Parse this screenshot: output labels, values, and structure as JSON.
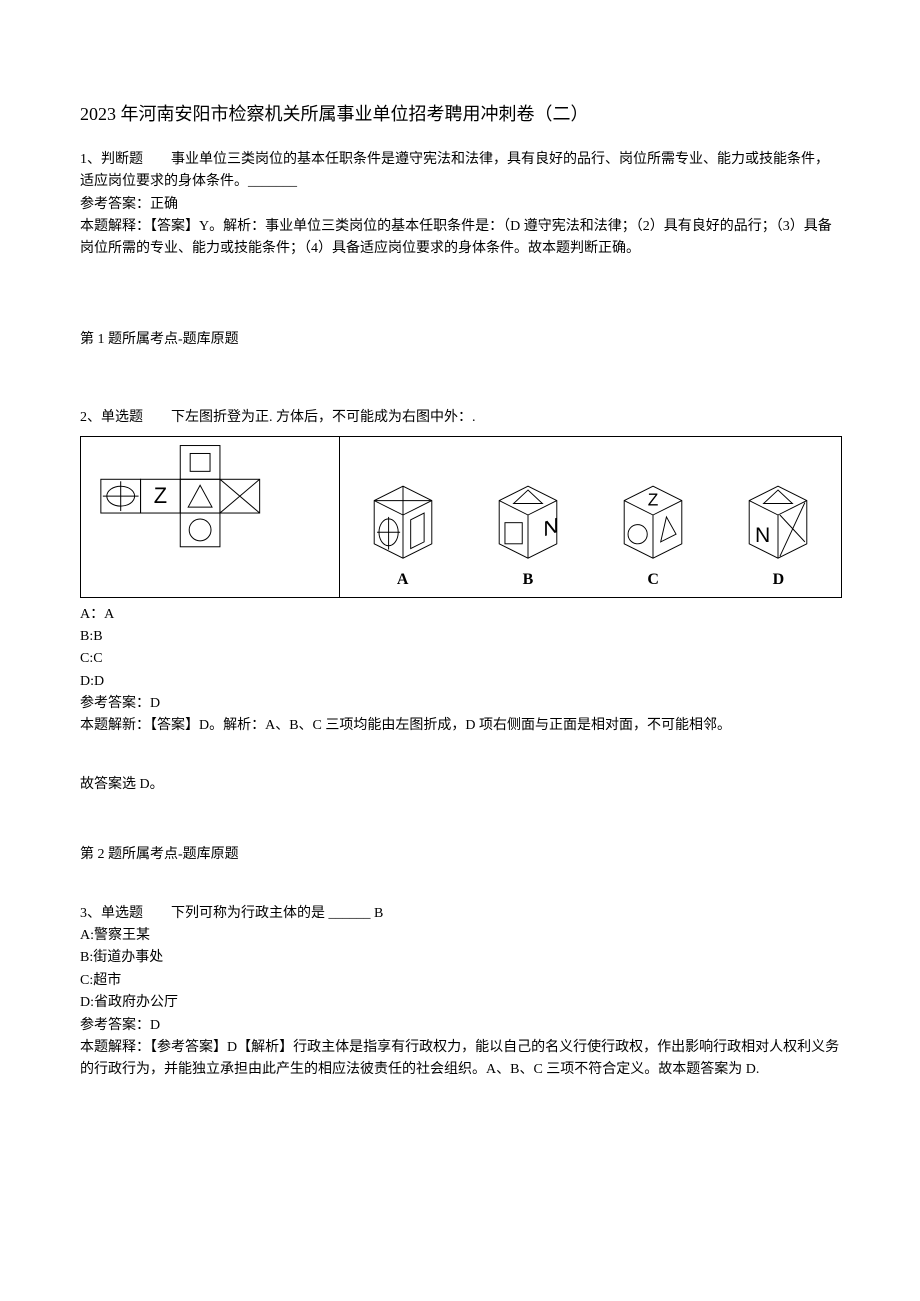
{
  "title": "2023 年河南安阳市检察机关所属事业单位招考聘用冲刺卷（二）",
  "q1": {
    "line1": "1、判断题  事业单位三类岗位的基本任职条件是遵守宪法和法律，具有良好的品行、岗位所需专业、能力或技能条件，适应岗位要求的身体条件。_______",
    "ans": "参考答案：正确",
    "exp": "本题解释：【答案】Y。解析：事业单位三类岗位的基本任职条件是：（D 遵守宪法和法律；（2）具有良好的品行；（3）具备岗位所需的专业、能力或技能条件；（4）具备适应岗位要求的身体条件。故本题判断正确。",
    "topic": "第 1 题所属考点-题库原题"
  },
  "q2": {
    "stem": "2、单选题  下左图折登为正. 方体后，不可能成为右图中外：.",
    "labels": {
      "a": "A",
      "b": "B",
      "c": "C",
      "d": "D"
    },
    "opts": {
      "a": "A：A",
      "b": "B:B",
      "c": "C:C",
      "d": "D:D"
    },
    "ans": "参考答案：D",
    "exp1": "本题解新：【答案】D。解析：A、B、C 三项均能由左图折成，D 项右侧面与正面是相对面，不可能相邻。",
    "exp2": "故答案选 D。",
    "topic": "第 2 题所属考点-题库原题"
  },
  "q3": {
    "stem": "3、单选题  下列可称为行政主体的是 ______ B",
    "a": "A:警察王某",
    "b": "B:街道办事处",
    "c": "C:超市",
    "d": "D:省政府办公厅",
    "ans": "参考答案：D",
    "exp": "本题解释：【参考答案】D【解析】行政主体是指享有行政权力，能以自己的名义行使行政权，作出影响行政相对人权利义务的行政行为，并能独立承担由此产生的相应法彼责任的社会组织。A、B、C 三项不符合定义。故本题答案为 D."
  }
}
